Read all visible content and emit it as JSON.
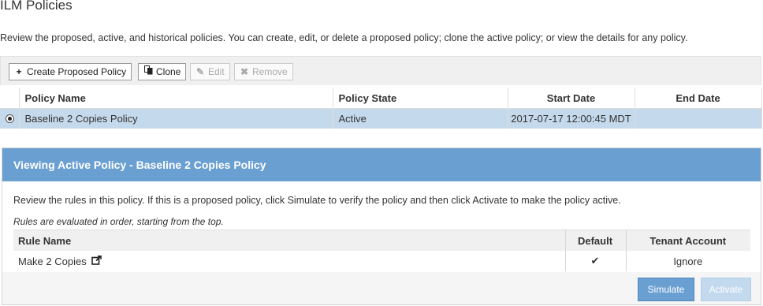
{
  "page": {
    "title": "ILM Policies",
    "description": "Review the proposed, active, and historical policies. You can create, edit, or delete a proposed policy; clone the active policy; or view the details for any policy."
  },
  "toolbar": {
    "create_label": "Create Proposed Policy",
    "clone_label": "Clone",
    "edit_label": "Edit",
    "remove_label": "Remove",
    "icons": {
      "create": "plus-icon",
      "clone": "copy-icon",
      "edit": "pencil-icon",
      "remove": "x-icon"
    }
  },
  "policies": {
    "columns": [
      "Policy Name",
      "Policy State",
      "Start Date",
      "End Date"
    ],
    "rows": [
      {
        "selected": true,
        "name": "Baseline 2 Copies Policy",
        "state": "Active",
        "start": "2017-07-17 12:00:45 MDT",
        "end": ""
      }
    ]
  },
  "panel": {
    "title": "Viewing Active Policy - Baseline 2 Copies Policy",
    "description": "Review the rules in this policy. If this is a proposed policy, click Simulate to verify the policy and then click Activate to make the policy active.",
    "note": "Rules are evaluated in order, starting from the top.",
    "rules": {
      "columns": [
        "Rule Name",
        "Default",
        "Tenant Account"
      ],
      "rows": [
        {
          "name": "Make 2 Copies",
          "default_mark": "✔",
          "tenant": "Ignore"
        }
      ]
    },
    "simulate_label": "Simulate",
    "activate_label": "Activate"
  },
  "colors": {
    "panel_header": "#6a9fd1",
    "selected_row": "#c5d9ec",
    "primary_button": "#6a9fd1",
    "disabled_button": "#c3d9ee"
  }
}
